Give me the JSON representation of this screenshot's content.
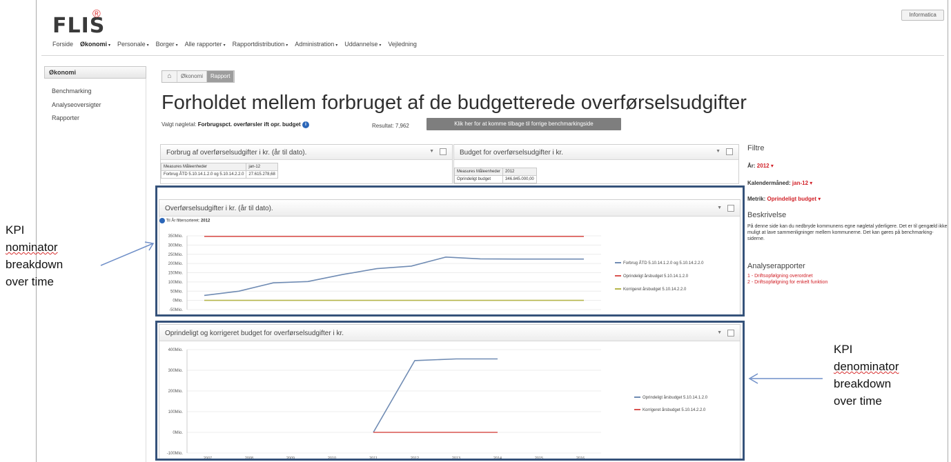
{
  "header": {
    "logo": "FLIS",
    "logo_mark": "®",
    "informatica": "Informatica"
  },
  "nav": [
    {
      "label": "Forside",
      "caret": false,
      "active": false
    },
    {
      "label": "Økonomi",
      "caret": true,
      "active": true
    },
    {
      "label": "Personale",
      "caret": true,
      "active": false
    },
    {
      "label": "Borger",
      "caret": true,
      "active": false
    },
    {
      "label": "Alle rapporter",
      "caret": true,
      "active": false
    },
    {
      "label": "Rapportdistribution",
      "caret": true,
      "active": false
    },
    {
      "label": "Administration",
      "caret": true,
      "active": false
    },
    {
      "label": "Uddannelse",
      "caret": true,
      "active": false
    },
    {
      "label": "Vejledning",
      "caret": false,
      "active": false
    }
  ],
  "sidebar": {
    "heading": "Økonomi",
    "items": [
      "Benchmarking",
      "Analyseoversigter",
      "Rapporter"
    ]
  },
  "breadcrumb": {
    "home_icon": "home-icon",
    "items": [
      "Økonomi"
    ],
    "current": "Rapport"
  },
  "page": {
    "title": "Forholdet mellem forbruget af de budgetterede overførselsudgifter",
    "kpi_label": "Valgt nøgletal:",
    "kpi_value": "Forbrugspct. overførsler ift opr. budget",
    "result_label": "Resultat:",
    "result_value": "7,962",
    "back_button": "Klik her for at komme tilbage til forrige benchmarkingside"
  },
  "panel_forbrug": {
    "title": "Forbrug af overførselsudgifter i kr. (år til dato).",
    "table": [
      [
        "Measures Måleenheder",
        "jan-12"
      ],
      [
        "Forbrug ÅTD 5.10.14.1.2.0 og 5.10.14.2.2.0",
        "27.615.278,68"
      ]
    ]
  },
  "panel_budget": {
    "title": "Budget for overførselsudgifter i kr.",
    "table": [
      [
        "Measures Måleenheder",
        "2012"
      ],
      [
        "Oprindeligt budget",
        "346.845.000,00"
      ]
    ]
  },
  "chart1_panel": {
    "title": "Overførselsudgifter i kr. (år til dato).",
    "filter_text": "Til År filtersorteret:",
    "filter_value": "2012"
  },
  "chart2_panel": {
    "title": "Oprindeligt og korrigeret budget for overførselsudgifter i kr."
  },
  "filters": {
    "title": "Filtre",
    "items": [
      {
        "label": "År:",
        "value": "2012"
      },
      {
        "label": "Kalendermåned:",
        "value": "jan-12"
      },
      {
        "label": "Metrik:",
        "value": "Oprindeligt budget"
      }
    ]
  },
  "description": {
    "title": "Beskrivelse",
    "text": "På denne side kan du nedbryde kommunens egne nøgletal yderligere. Det er til gengæld ikke muligt at lave sammenligninger mellem kommunerne. Det kan gøres på benchmarking-siderne."
  },
  "analysis": {
    "title": "Analyserapporter",
    "links": [
      "1 - Driftsopfølgning overordnet",
      "2 - Driftsopfølgning for enkelt funktion"
    ]
  },
  "annotations": {
    "left": [
      "KPI",
      "nominator",
      "breakdown",
      "over time"
    ],
    "right": [
      "KPI",
      "denominator",
      "breakdown",
      "over time"
    ]
  },
  "colors": {
    "highlight": "#35527a",
    "series_blue": "#6f8bb3",
    "series_red": "#d9534f",
    "series_olive": "#b5b54a",
    "filter_value": "#d11f26"
  },
  "chart_data": [
    {
      "type": "line",
      "y_ticks": [
        "350Mio.",
        "300Mio.",
        "250Mio.",
        "200Mio.",
        "150Mio.",
        "100Mio.",
        "50Mio.",
        "0Mio.",
        "-50Mio."
      ],
      "ylim": [
        -50,
        350
      ],
      "series": [
        {
          "name": "Forbrug ÅTD 5.10.14.1.2.0 og 5.10.14.2.2.0",
          "color": "#6f8bb3",
          "values": [
            27,
            50,
            95,
            102,
            140,
            172,
            186,
            235,
            225,
            224,
            224,
            224
          ]
        },
        {
          "name": "Oprindeligt årsbudget 5.10.14.1.2.0",
          "color": "#d9534f",
          "values": [
            347,
            347,
            347,
            347,
            347,
            347,
            347,
            347,
            347,
            347,
            347,
            347
          ]
        },
        {
          "name": "Korrigeret årsbudget 5.10.14.2.2.0",
          "color": "#b5b54a",
          "values": [
            0,
            0,
            0,
            0,
            0,
            0,
            0,
            0,
            0,
            0,
            0,
            0
          ]
        }
      ]
    },
    {
      "type": "line",
      "x": [
        "2007",
        "2008",
        "2009",
        "2010",
        "2011",
        "2012",
        "2013",
        "2014",
        "2015",
        "2016"
      ],
      "y_ticks": [
        "400Mio.",
        "300Mio.",
        "200Mio.",
        "100Mio.",
        "0Mio.",
        "-100Mio."
      ],
      "ylim": [
        -100,
        400
      ],
      "series": [
        {
          "name": "Oprindeligt årsbudget 5.10.14.1.2.0",
          "color": "#6f8bb3",
          "values": [
            null,
            null,
            null,
            null,
            0,
            347,
            355,
            355,
            null,
            null
          ]
        },
        {
          "name": "Korrigeret årsbudget 5.10.14.2.2.0",
          "color": "#d9534f",
          "values": [
            null,
            null,
            null,
            null,
            0,
            0,
            0,
            0,
            null,
            null
          ]
        }
      ]
    }
  ]
}
